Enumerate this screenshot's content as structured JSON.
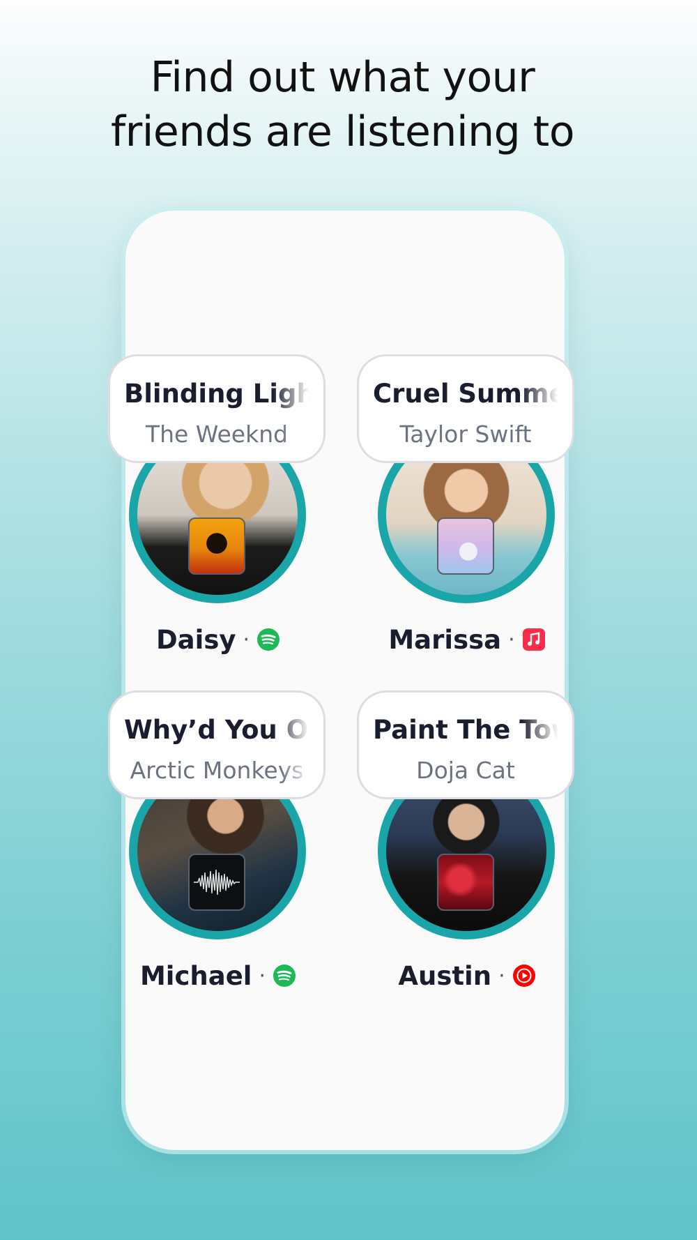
{
  "headline": {
    "line1": "Find out what your",
    "line2": "friends are listening to"
  },
  "friends": [
    {
      "name": "Daisy",
      "song": "Blinding Lights",
      "artist": "The Weeknd",
      "service": "spotify",
      "service_color": "#1DB954",
      "album_icon": "album-art-after-hours"
    },
    {
      "name": "Marissa",
      "song": "Cruel Summer",
      "artist": "Taylor Swift",
      "service": "apple-music",
      "service_color": "#FA2D48",
      "album_icon": "album-art-lover"
    },
    {
      "name": "Michael",
      "song": "Why’d You Only Call Me When You’re High?",
      "artist": "Arctic Monkeys",
      "service": "spotify",
      "service_color": "#1DB954",
      "album_icon": "album-art-am"
    },
    {
      "name": "Austin",
      "song": "Paint The Town Red",
      "artist": "Doja Cat",
      "service": "youtube-music",
      "service_color": "#FF0000",
      "album_icon": "album-art-scarlet"
    }
  ],
  "separator": "·",
  "colors": {
    "ring": "#1AA6A8",
    "background_bottom": "#5FC4C9"
  }
}
